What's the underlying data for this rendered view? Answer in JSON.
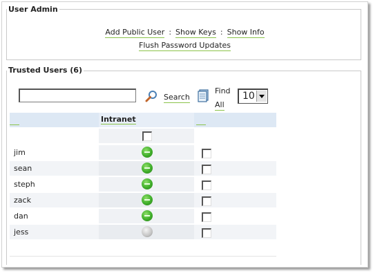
{
  "user_admin": {
    "legend": "User Admin",
    "links": {
      "add_public_user": "Add Public User",
      "show_keys": "Show Keys",
      "show_info": "Show Info",
      "flush_password_updates": "Flush Password Updates"
    },
    "separator": ":"
  },
  "trusted_users": {
    "legend": "Trusted Users (6)",
    "search": {
      "value": "",
      "search_label": "Search",
      "find_all_line1": "Find",
      "find_all_line2": "All",
      "page_size": "10"
    },
    "columns": {
      "intranet": "Intranet"
    },
    "users": [
      {
        "name": "jim",
        "intranet_key": "active",
        "selected": false
      },
      {
        "name": "sean",
        "intranet_key": "active",
        "selected": false
      },
      {
        "name": "steph",
        "intranet_key": "active",
        "selected": false
      },
      {
        "name": "zack",
        "intranet_key": "active",
        "selected": false
      },
      {
        "name": "dan",
        "intranet_key": "active",
        "selected": false
      },
      {
        "name": "jess",
        "intranet_key": "inactive",
        "selected": false
      }
    ]
  },
  "colors": {
    "accent_underline": "#8bc34a",
    "header_bg": "#dde8f4",
    "key_active": "#3fae2a",
    "key_inactive": "#c4c4c4"
  }
}
